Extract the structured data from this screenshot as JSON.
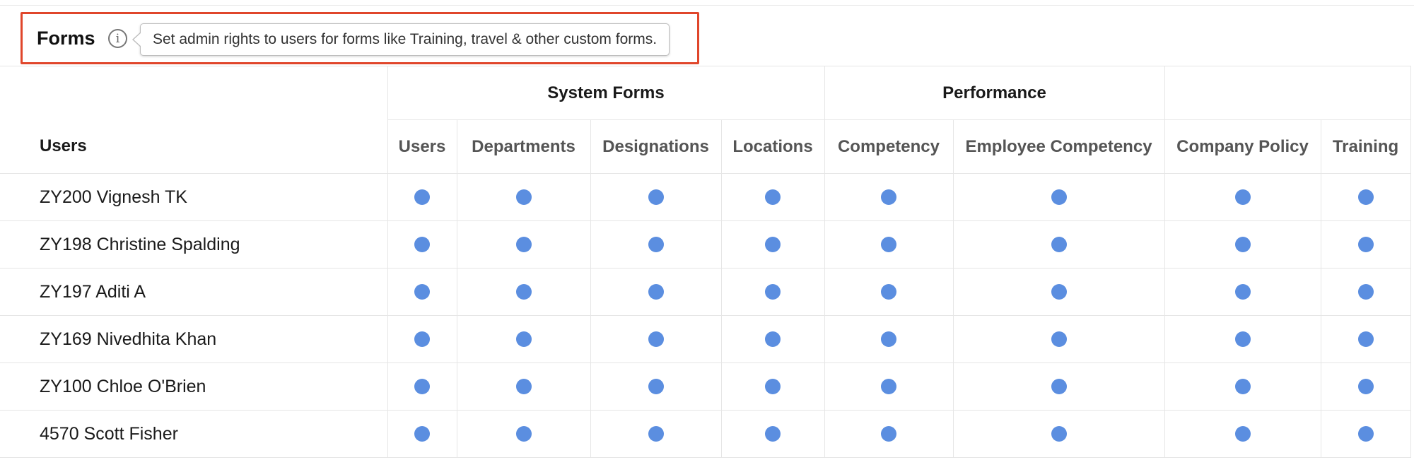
{
  "section": {
    "title": "Forms",
    "info_tooltip": "Set admin rights to users for forms like Training, travel & other custom forms."
  },
  "table": {
    "users_header": "Users",
    "groups": [
      {
        "label": "System Forms"
      },
      {
        "label": "Performance"
      },
      {
        "label": ""
      }
    ],
    "columns": [
      "Users",
      "Departments",
      "Designations",
      "Locations",
      "Competency",
      "Employee Competency",
      "Company Policy",
      "Training"
    ],
    "rows": [
      {
        "user": "ZY200 Vignesh TK"
      },
      {
        "user": "ZY198 Christine Spalding"
      },
      {
        "user": "ZY197 Aditi A"
      },
      {
        "user": "ZY169 Nivedhita Khan"
      },
      {
        "user": "ZY100 Chloe O'Brien"
      },
      {
        "user": "4570 Scott Fisher"
      }
    ],
    "dot_color": "#5b8ee0",
    "border_color": "#e6e6e6"
  },
  "highlight_color": "#e0462b"
}
